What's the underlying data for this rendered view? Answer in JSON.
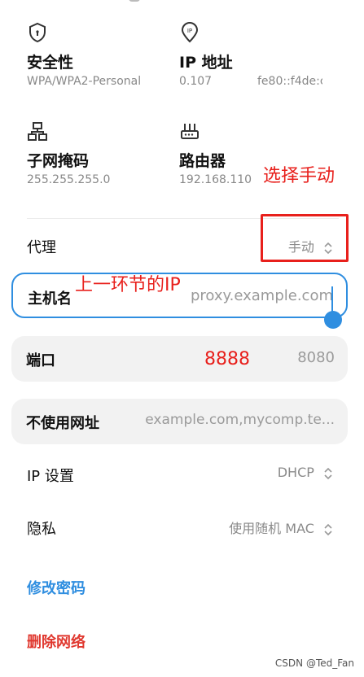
{
  "info": {
    "security": {
      "icon": "shield-icon",
      "title": "安全性",
      "value": "WPA/WPA2-Personal"
    },
    "ip": {
      "icon": "ip-pin-icon",
      "title": "IP 地址",
      "value": "0.107",
      "value2": "fe80::f4de:c"
    },
    "subnet": {
      "icon": "network-icon",
      "title": "子网掩码",
      "value": "255.255.255.0"
    },
    "router": {
      "icon": "router-icon",
      "title": "路由器",
      "value": "192.168.110.1"
    }
  },
  "proxy": {
    "label": "代理",
    "value": "手动"
  },
  "hostname": {
    "label": "主机名",
    "value": "proxy.example.com"
  },
  "port": {
    "label": "端口",
    "value": "8080"
  },
  "bypass": {
    "label": "不使用网址",
    "value": "example.com,mycomp.te..."
  },
  "ip_settings": {
    "label": "IP 设置",
    "value": "DHCP"
  },
  "privacy": {
    "label": "隐私",
    "value": "使用随机 MAC"
  },
  "actions": {
    "modify_password": "修改密码",
    "delete_network": "删除网络"
  },
  "annotations": {
    "select_manual": "选择手动",
    "previous_ip": "上一环节的IP",
    "port_value": "8888"
  },
  "watermark": "CSDN @Ted_Fan",
  "colors": {
    "accent": "#2f8ee0",
    "danger": "#e0382f",
    "annotation": "#e8201c"
  }
}
